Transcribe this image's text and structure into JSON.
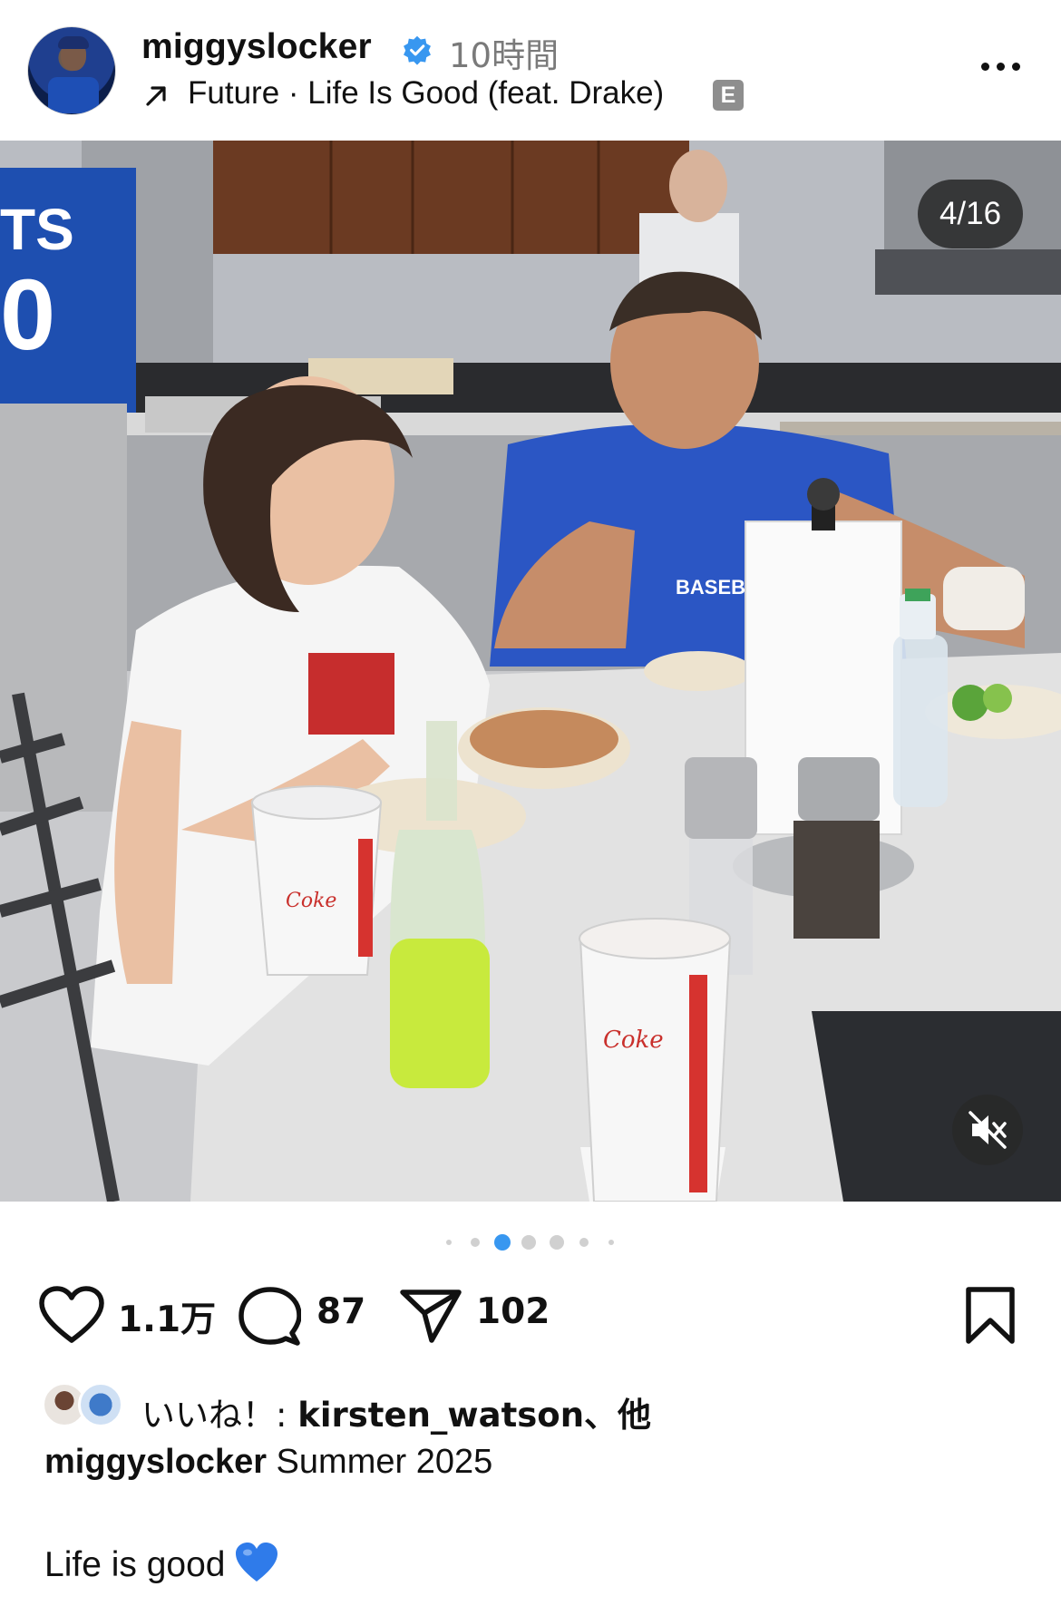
{
  "header": {
    "username": "miggyslocker",
    "verified": true,
    "time_ago": "10時間",
    "music": {
      "text": "Future · Life Is Good (feat. Drake)",
      "explicit_label": "E"
    },
    "avatar_icon": "profile-avatar",
    "more_icon": "more-horizontal-icon"
  },
  "media": {
    "counter": "4/16",
    "mute_icon": "muted-speaker-icon",
    "photo_description_icon": "photo"
  },
  "carousel": {
    "dots_count": 7,
    "active_index": 2
  },
  "actions": {
    "like_count": "1.1万",
    "comment_count": "87",
    "share_count": "102",
    "like_icon": "heart-icon",
    "comment_icon": "comment-bubble-icon",
    "share_icon": "paper-plane-icon",
    "save_icon": "bookmark-icon"
  },
  "likes": {
    "prefix": "いいね！: ",
    "user": "kirsten_watson",
    "suffix": "、他"
  },
  "caption": {
    "username": "miggyslocker",
    "line1": " Summer 2025",
    "line2": "Life is good"
  },
  "colors": {
    "verified_blue": "#3897f0",
    "active_dot": "#3897f0",
    "blue_heart": "#2f7bea",
    "muted_text": "#7a7a7a"
  }
}
